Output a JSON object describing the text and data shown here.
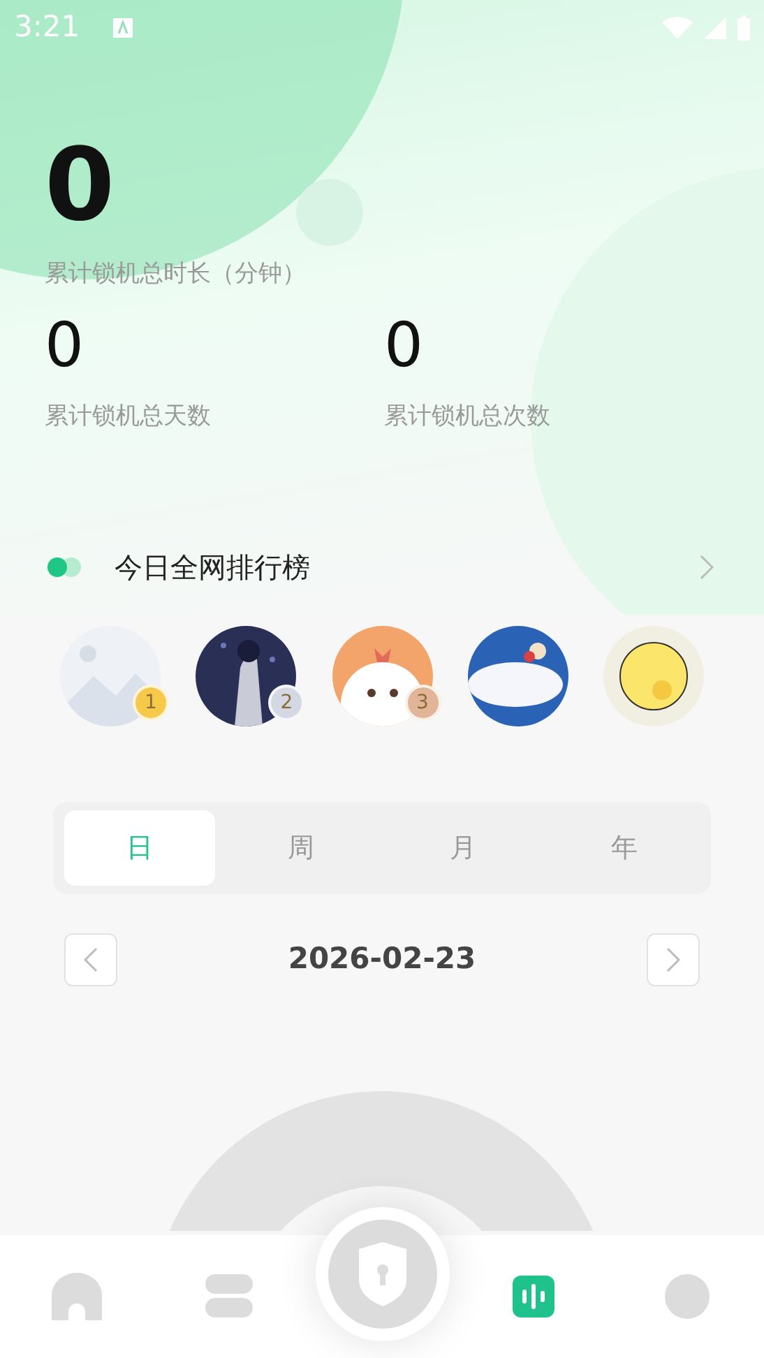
{
  "status_bar": {
    "time": "3:21"
  },
  "stats": {
    "main": {
      "value": "0",
      "label": "累计锁机总时长（分钟）"
    },
    "secondary": [
      {
        "value": "0",
        "label": "累计锁机总天数"
      },
      {
        "value": "0",
        "label": "累计锁机总次数"
      }
    ]
  },
  "ranking": {
    "title": "今日全网排行榜",
    "avatars": [
      {
        "kind": "picture",
        "rank": "1",
        "color": "#f7c94a"
      },
      {
        "kind": "picture",
        "rank": "2",
        "color": "#d3d8e2"
      },
      {
        "kind": "picture",
        "rank": "3",
        "color": "#e2b598"
      },
      {
        "kind": "picture"
      },
      {
        "kind": "picture"
      }
    ]
  },
  "periods": [
    {
      "label": "日",
      "selected": true
    },
    {
      "label": "周",
      "selected": false
    },
    {
      "label": "月",
      "selected": false
    },
    {
      "label": "年",
      "selected": false
    }
  ],
  "date": "2026-02-23",
  "nav": [
    {
      "kind": "home",
      "selected": false
    },
    {
      "kind": "list",
      "selected": false
    },
    {
      "kind": "lock",
      "selected": false
    },
    {
      "kind": "stats",
      "selected": true
    },
    {
      "kind": "profile",
      "selected": false
    }
  ]
}
